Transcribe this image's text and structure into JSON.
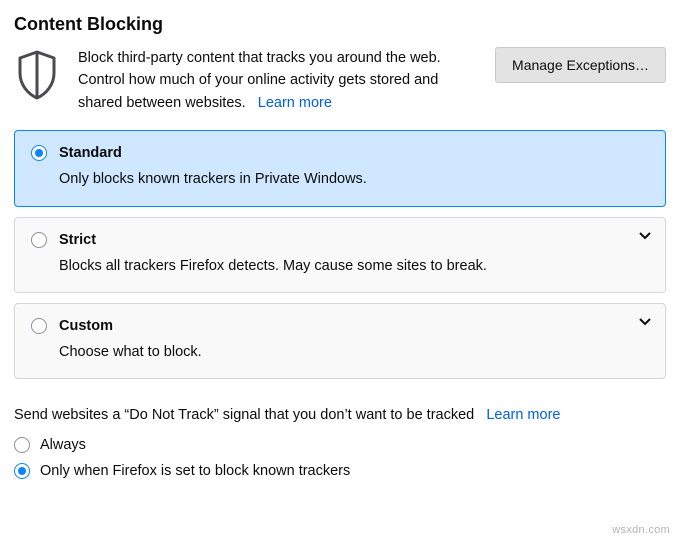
{
  "section_title": "Content Blocking",
  "intro": {
    "text": "Block third-party content that tracks you around the web. Control how much of your online activity gets stored and shared between websites.",
    "learn_more": "Learn more"
  },
  "manage_exceptions_label": "Manage Exceptions…",
  "options": {
    "standard": {
      "title": "Standard",
      "desc": "Only blocks known trackers in Private Windows."
    },
    "strict": {
      "title": "Strict",
      "desc": "Blocks all trackers Firefox detects. May cause some sites to break."
    },
    "custom": {
      "title": "Custom",
      "desc": "Choose what to block."
    }
  },
  "dnt": {
    "label": "Send websites a “Do Not Track” signal that you don’t want to be tracked",
    "learn_more": "Learn more",
    "always": "Always",
    "only_when": "Only when Firefox is set to block known trackers"
  },
  "watermark": "wsxdn.com"
}
